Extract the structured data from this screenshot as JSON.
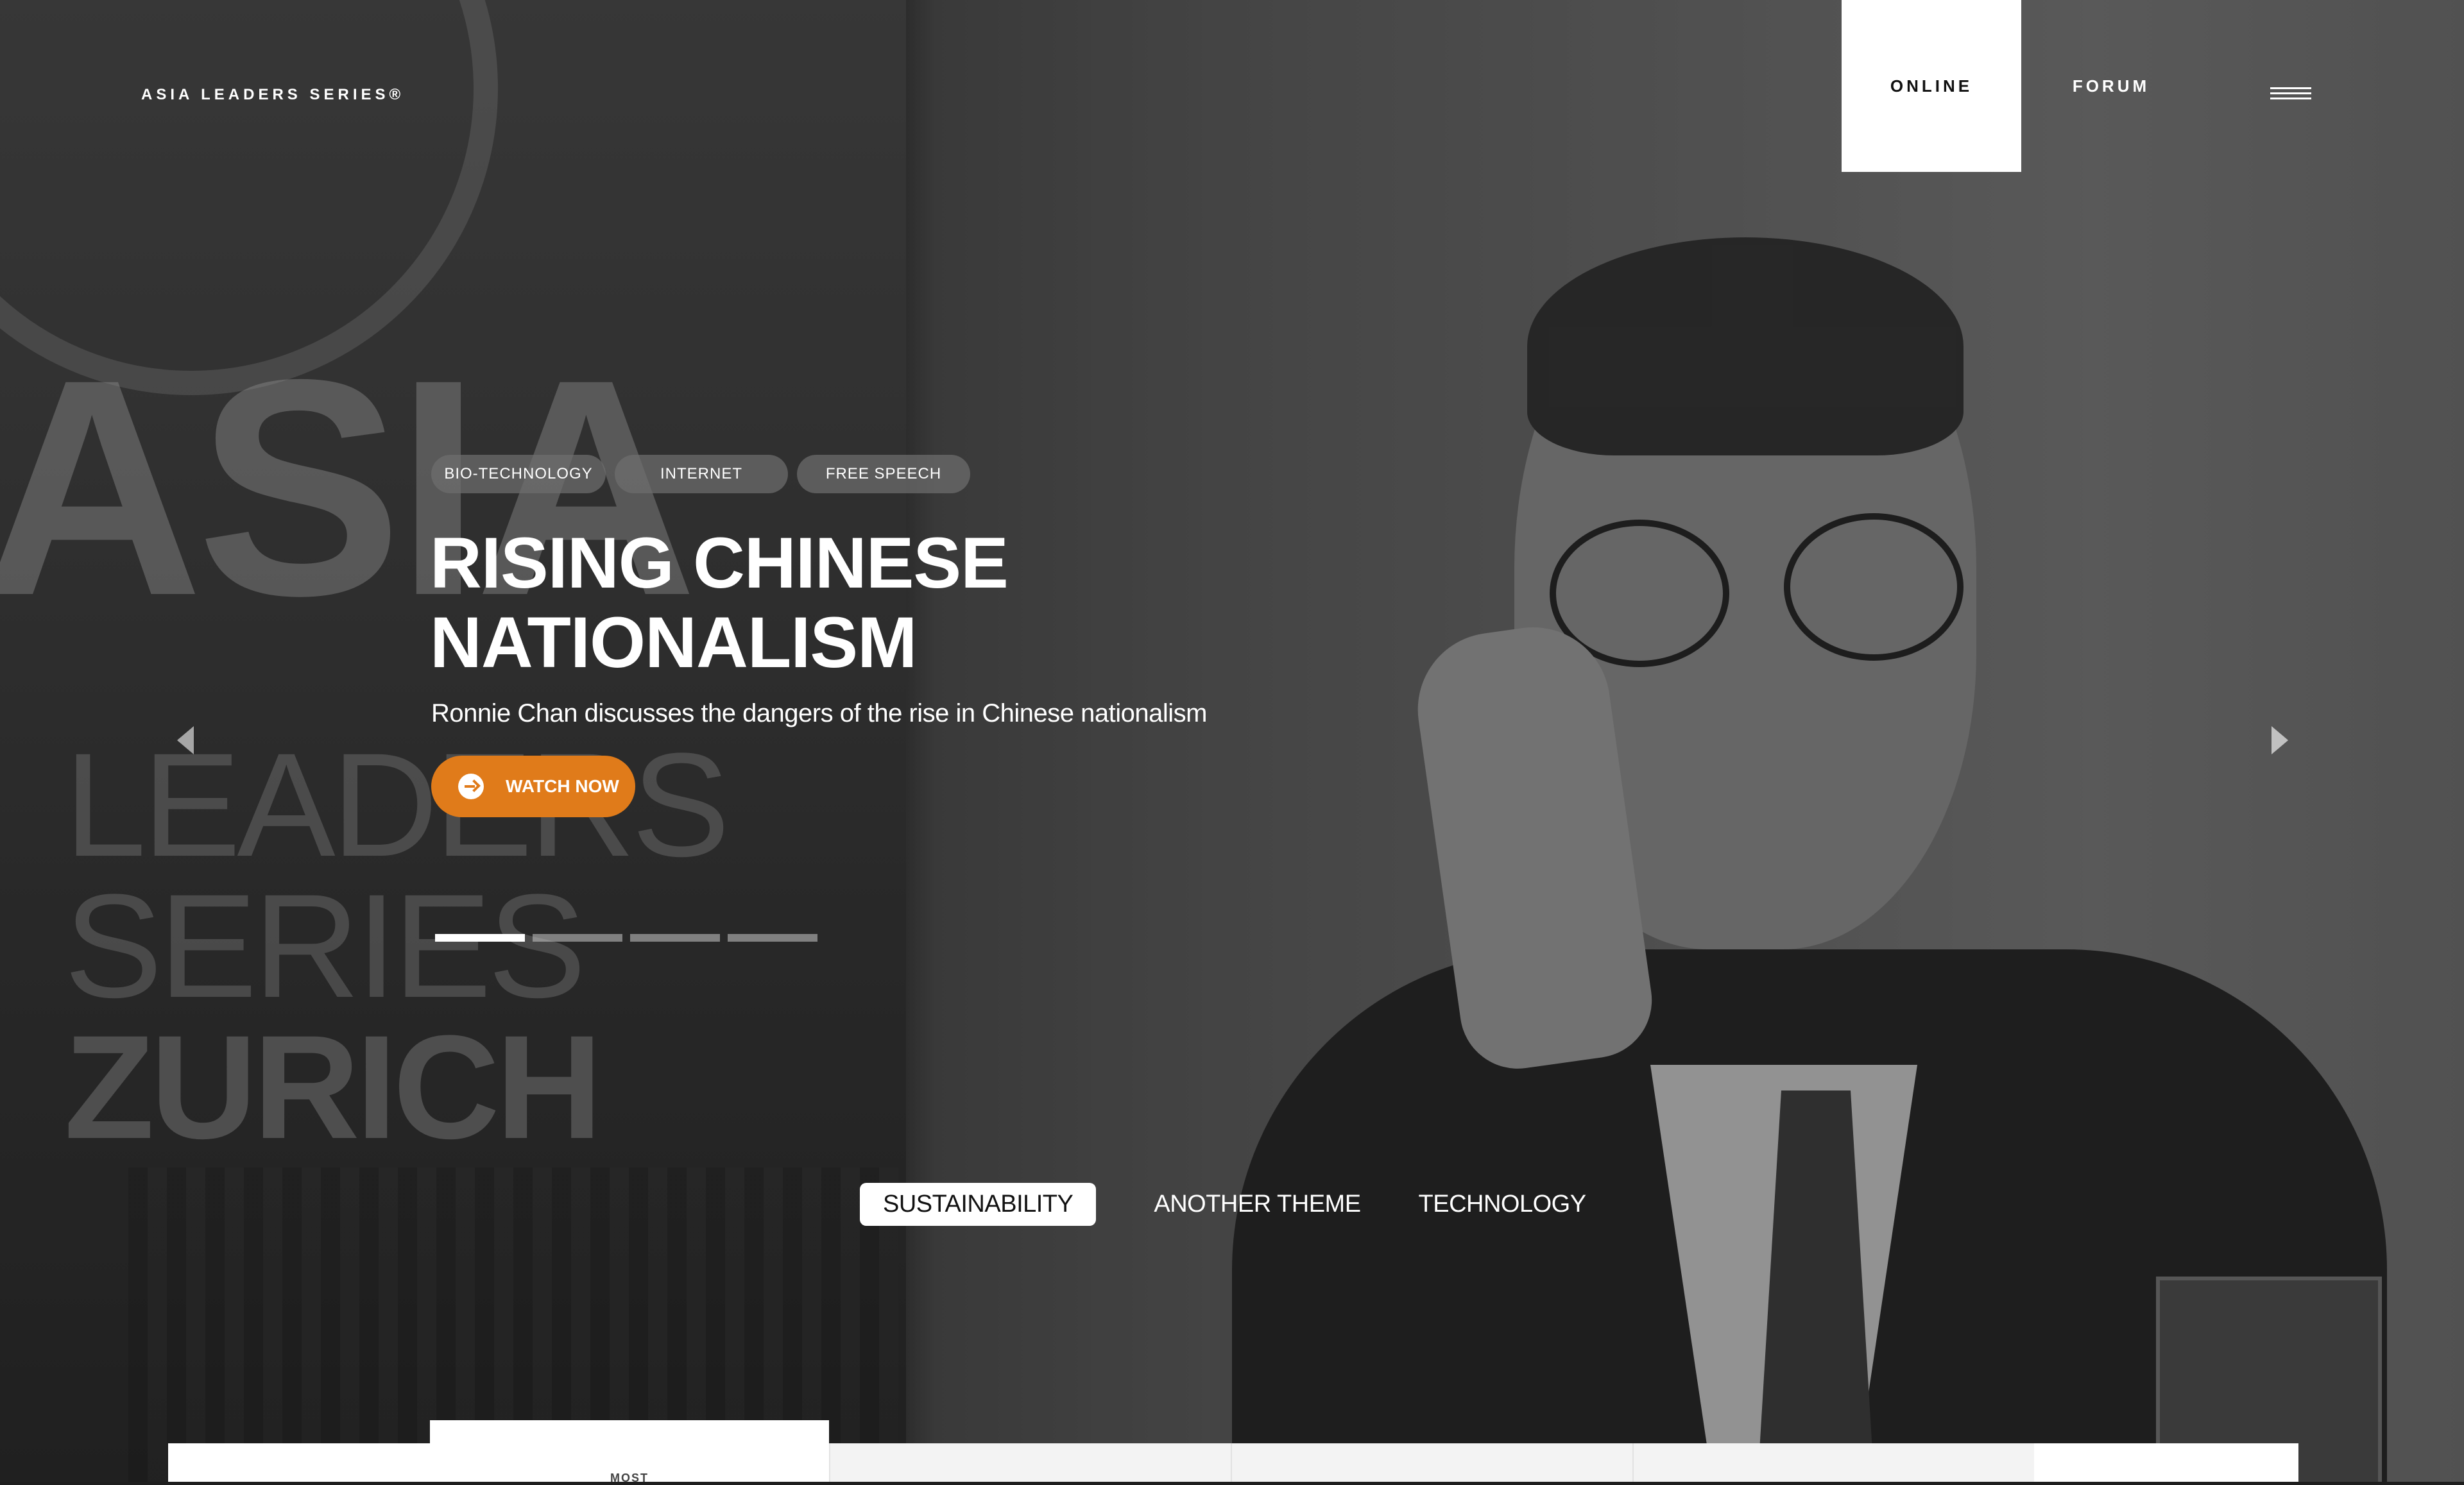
{
  "header": {
    "logo": "ASIA LEADERS SERIES®",
    "nav": [
      {
        "label": "ONLINE",
        "active": true
      },
      {
        "label": "FORUM",
        "active": false
      }
    ],
    "menu_icon": "hamburger-icon"
  },
  "hero": {
    "background_words": [
      "ASIA",
      "LEADERS",
      "SERIES",
      "ZURICH"
    ],
    "tags": [
      "BIO-TECHNOLOGY",
      "INTERNET",
      "FREE SPEECH"
    ],
    "title_line1": "RISING CHINESE",
    "title_line2": "NATIONALISM",
    "subtitle": "Ronnie Chan discusses the dangers of the rise in Chinese nationalism",
    "cta_label": "WATCH NOW",
    "cta_color": "#e07b1a",
    "slides_total": 4,
    "slide_active": 1
  },
  "themes": [
    {
      "label": "SUSTAINABILITY",
      "active": true
    },
    {
      "label": "ANOTHER THEME",
      "active": false
    },
    {
      "label": "TECHNOLOGY",
      "active": false
    }
  ],
  "bottom_tab_label": "MOST"
}
